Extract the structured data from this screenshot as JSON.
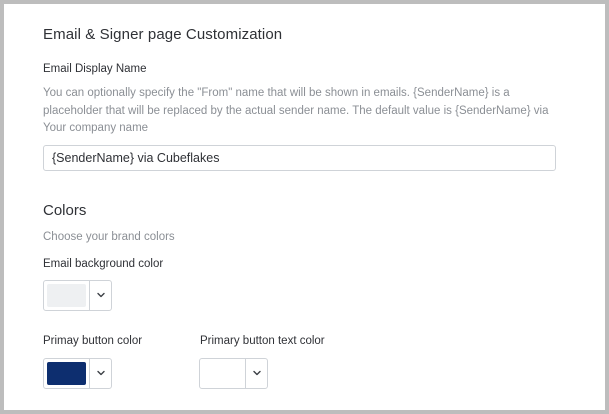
{
  "section": {
    "title": "Email & Signer page Customization"
  },
  "email_display_name": {
    "label": "Email Display Name",
    "help": "You can optionally specify the \"From\" name that will be shown in emails. {SenderName} is a placeholder that will be replaced by the actual sender name. The default value is {SenderName} via Your company name",
    "value": "{SenderName} via Cubeflakes"
  },
  "colors": {
    "title": "Colors",
    "subtitle": "Choose your brand colors",
    "email_background": {
      "label": "Email background color",
      "color": "#eef0f2"
    },
    "primary_button": {
      "label": "Primay button color",
      "color": "#0d2e6f"
    },
    "primary_button_text": {
      "label": "Primary button text color",
      "color": "#ffffff"
    }
  },
  "icons": {
    "dropdown": "chevron-down-icon"
  }
}
